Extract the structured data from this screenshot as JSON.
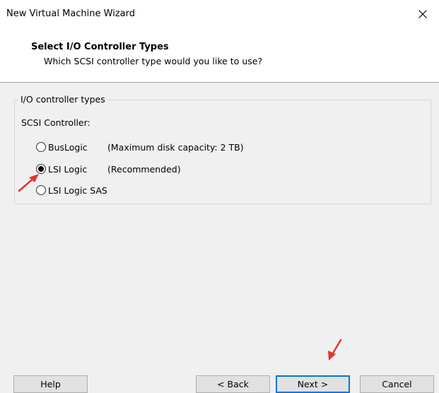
{
  "window": {
    "title": "New Virtual Machine Wizard"
  },
  "header": {
    "title": "Select I/O Controller Types",
    "subtitle": "Which SCSI controller type would you like to use?"
  },
  "group": {
    "legend": "I/O controller types",
    "scsi_label": "SCSI Controller:",
    "options": [
      {
        "label": "BusLogic",
        "note": "(Maximum disk capacity: 2 TB)",
        "checked": false
      },
      {
        "label": "LSI Logic",
        "note": "(Recommended)",
        "checked": true
      },
      {
        "label": "LSI Logic SAS",
        "note": "",
        "checked": false
      }
    ]
  },
  "buttons": {
    "help": "Help",
    "back": "< Back",
    "next": "Next >",
    "cancel": "Cancel"
  },
  "colors": {
    "annotation_arrow": "#e0362e",
    "default_button_border": "#0078d7"
  }
}
